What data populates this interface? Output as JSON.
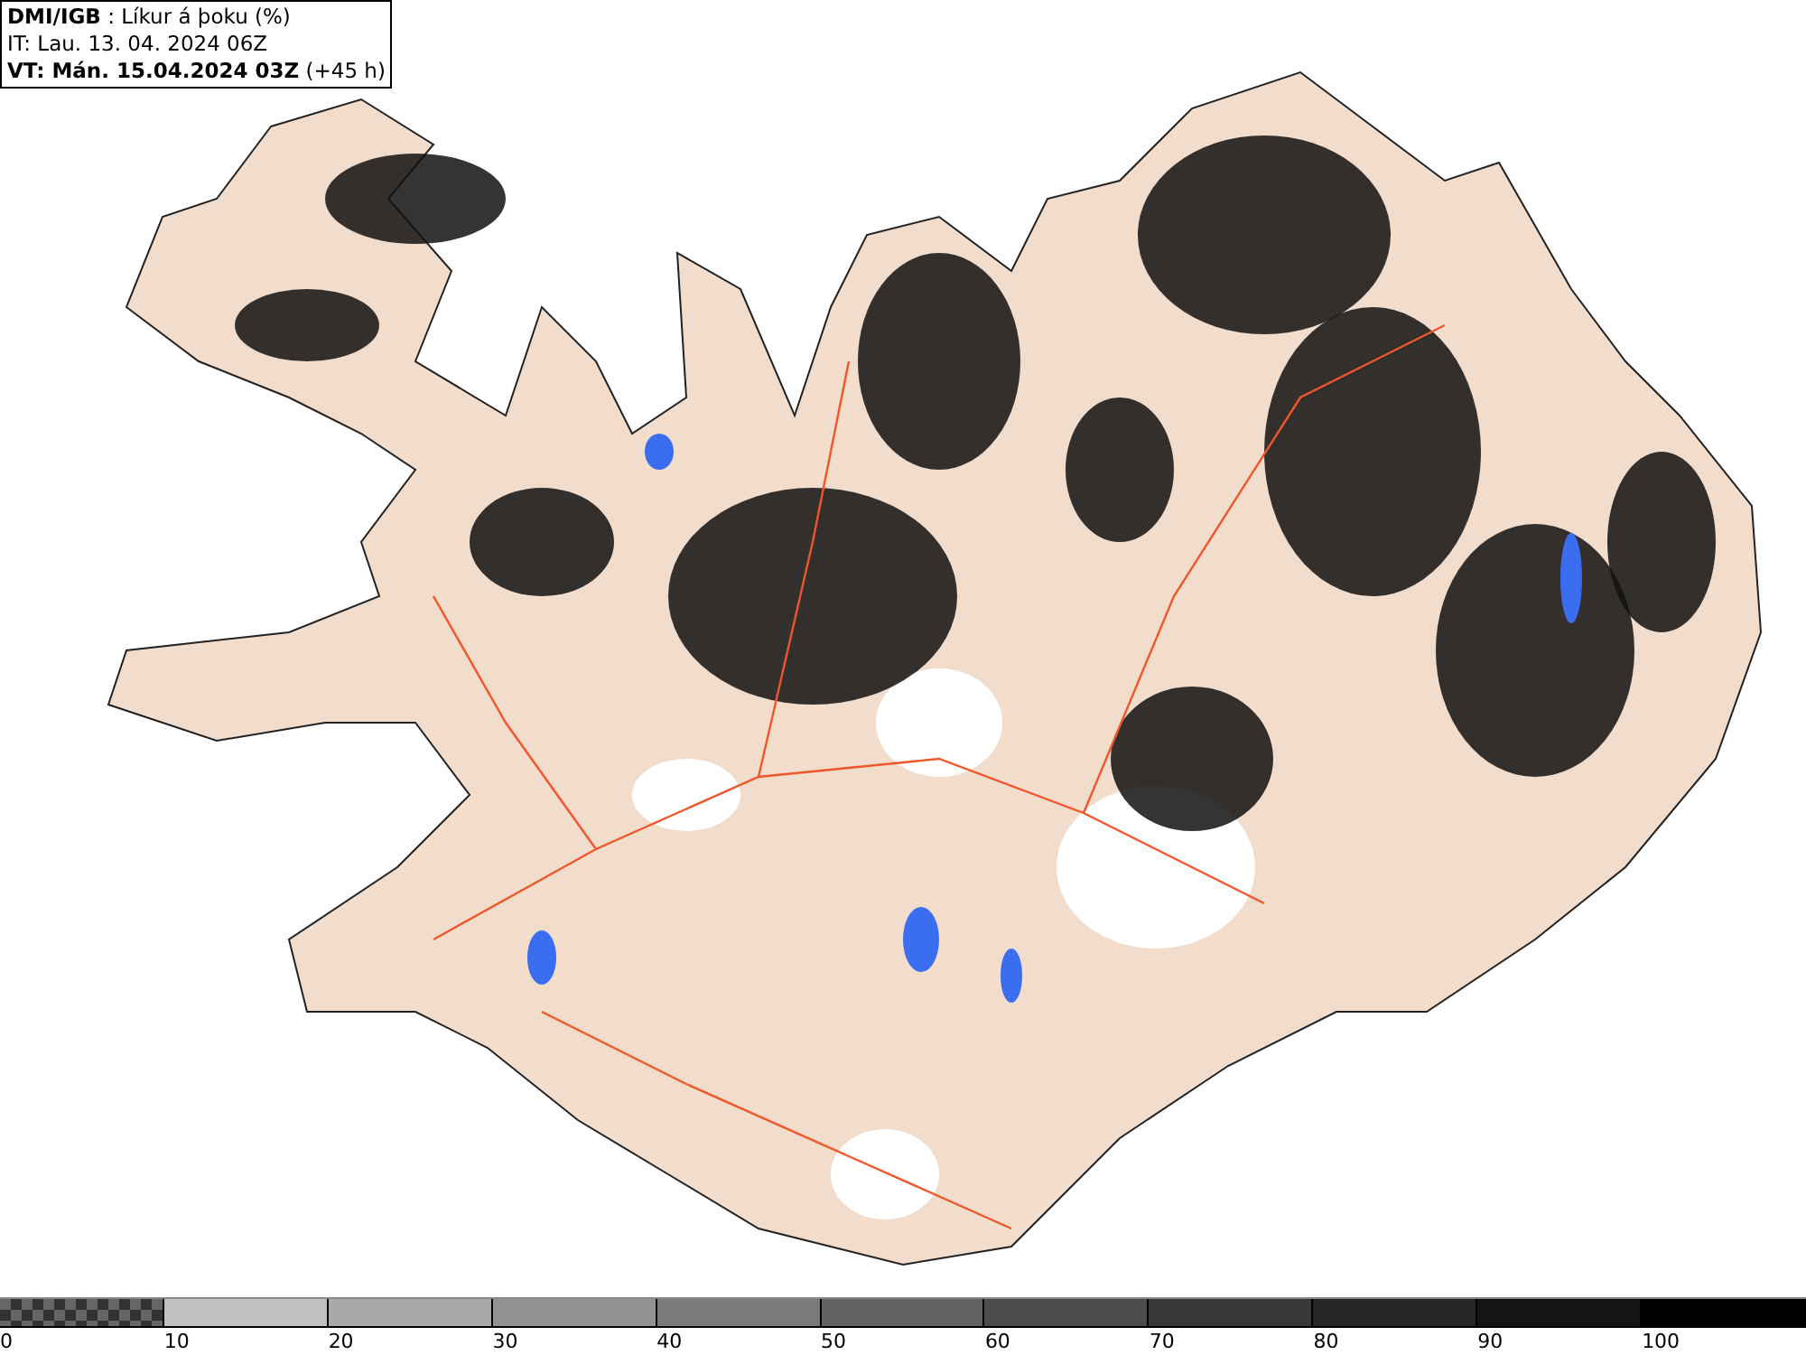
{
  "header": {
    "lines": [
      "**DMI/IGB** : Líkur á þoku (%)",
      "IT: Lau. 13. 04. 2024 06Z",
      "**VT: Mán. 15.04.2024 03Z** (+45 h)"
    ]
  },
  "legend": {
    "items": [
      {
        "label": "0",
        "kind": "checker",
        "color": "#666666"
      },
      {
        "label": "10",
        "kind": "solid",
        "color": "#c0c0c0"
      },
      {
        "label": "20",
        "kind": "solid",
        "color": "#a9a9a9"
      },
      {
        "label": "30",
        "kind": "solid",
        "color": "#929292"
      },
      {
        "label": "40",
        "kind": "solid",
        "color": "#7a7a7a"
      },
      {
        "label": "50",
        "kind": "solid",
        "color": "#636363"
      },
      {
        "label": "60",
        "kind": "solid",
        "color": "#4c4c4c"
      },
      {
        "label": "70",
        "kind": "solid",
        "color": "#383838"
      },
      {
        "label": "80",
        "kind": "solid",
        "color": "#262626"
      },
      {
        "label": "90",
        "kind": "solid",
        "color": "#141414"
      },
      {
        "label": "100",
        "kind": "solid",
        "color": "#000000"
      }
    ]
  }
}
